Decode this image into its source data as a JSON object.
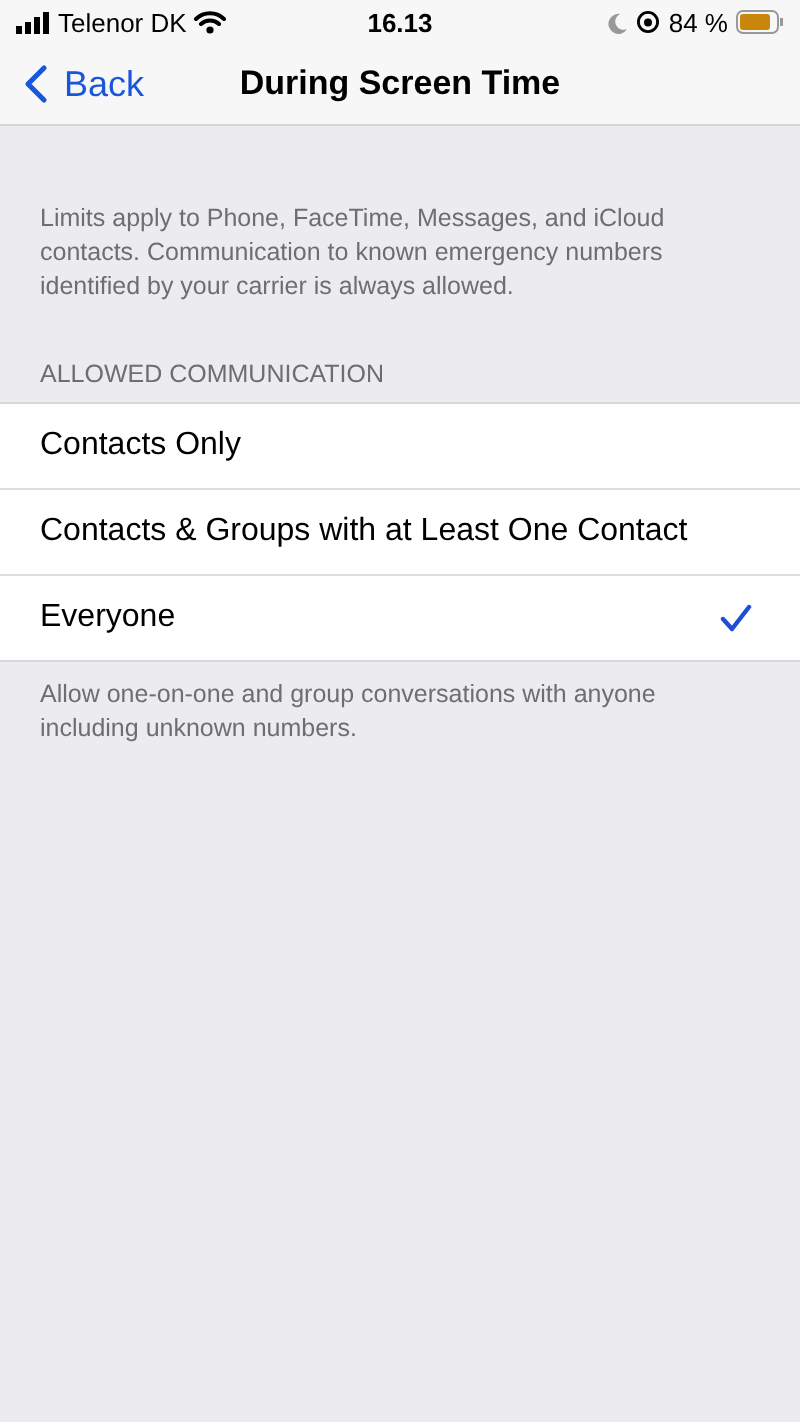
{
  "status_bar": {
    "carrier": "Telenor DK",
    "time": "16.13",
    "battery": "84 %"
  },
  "nav": {
    "back": "Back",
    "title": "During Screen Time"
  },
  "intro": "Limits apply to Phone, FaceTime, Messages, and iCloud contacts. Communication to known emergency numbers identified by your carrier is always allowed.",
  "section": {
    "header": "ALLOWED COMMUNICATION",
    "options": [
      {
        "label": "Contacts Only",
        "selected": false
      },
      {
        "label": "Contacts & Groups with at Least One Contact",
        "selected": false
      },
      {
        "label": "Everyone",
        "selected": true
      }
    ],
    "footer": "Allow one-on-one and group conversations with anyone including unknown numbers."
  }
}
